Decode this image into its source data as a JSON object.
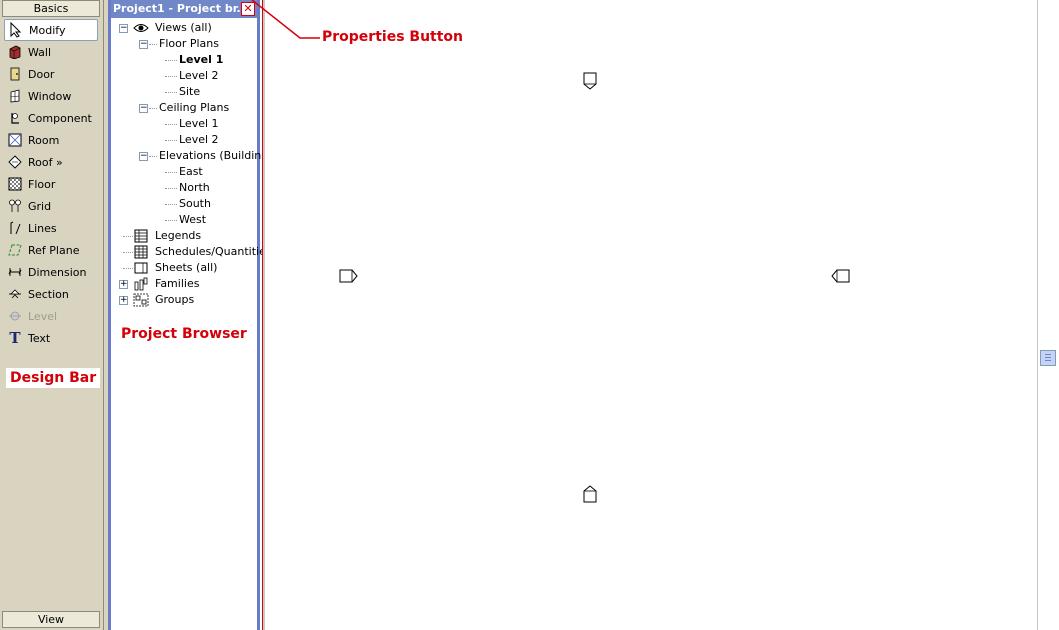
{
  "design_bar": {
    "header": "Basics",
    "footer": "View",
    "caption": "Design Bar",
    "items": [
      {
        "label": "Modify",
        "icon": "arrow-cursor-icon"
      },
      {
        "label": "Wall",
        "icon": "wall-icon"
      },
      {
        "label": "Door",
        "icon": "door-icon"
      },
      {
        "label": "Window",
        "icon": "window-icon"
      },
      {
        "label": "Component",
        "icon": "component-icon"
      },
      {
        "label": "Room",
        "icon": "room-icon"
      },
      {
        "label": "Roof »",
        "icon": "roof-icon"
      },
      {
        "label": "Floor",
        "icon": "floor-icon"
      },
      {
        "label": "Grid",
        "icon": "grid-icon"
      },
      {
        "label": "Lines",
        "icon": "lines-icon"
      },
      {
        "label": "Ref Plane",
        "icon": "ref-plane-icon"
      },
      {
        "label": "Dimension",
        "icon": "dimension-icon"
      },
      {
        "label": "Section",
        "icon": "section-icon"
      },
      {
        "label": "Level",
        "icon": "level-icon"
      },
      {
        "label": "Text",
        "icon": "text-icon"
      }
    ]
  },
  "project_browser": {
    "title": "Project1 - Project br...",
    "close_icon": "close-icon",
    "caption": "Project Browser",
    "tree": {
      "views": "Views (all)",
      "floor_plans": "Floor Plans",
      "fp_level1": "Level 1",
      "fp_level2": "Level 2",
      "fp_site": "Site",
      "ceiling_plans": "Ceiling Plans",
      "cp_level1": "Level 1",
      "cp_level2": "Level 2",
      "elevations": "Elevations (Building",
      "el_east": "East",
      "el_north": "North",
      "el_south": "South",
      "el_west": "West",
      "legends": "Legends",
      "schedules": "Schedules/Quantitie",
      "sheets": "Sheets (all)",
      "families": "Families",
      "groups": "Groups"
    }
  },
  "drawing_area": {
    "properties_caption": "Properties Button",
    "markers": [
      "elevation-marker-north",
      "elevation-marker-west",
      "elevation-marker-east",
      "elevation-marker-south"
    ]
  },
  "colors": {
    "annotation_red": "#d4000a",
    "browser_title_bg": "#7088c8",
    "design_bar_bg": "#d8d4c0"
  }
}
